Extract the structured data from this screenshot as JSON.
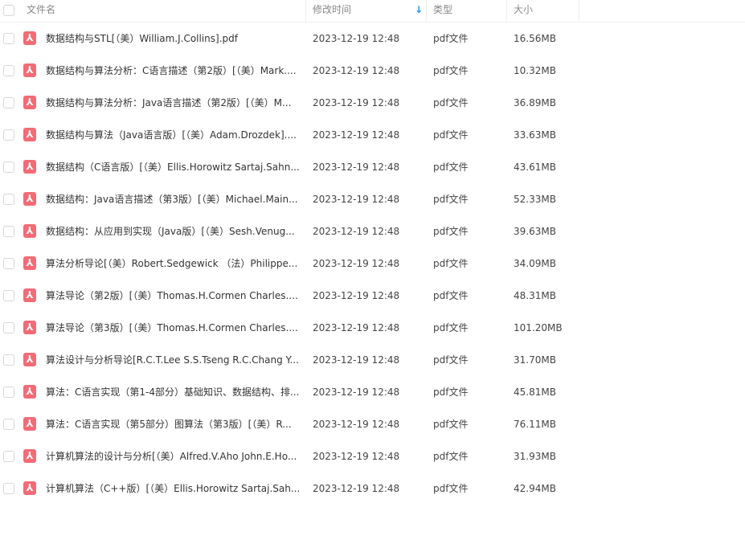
{
  "header": {
    "name": "文件名",
    "time": "修改时间",
    "type": "类型",
    "size": "大小",
    "sort_icon": "arrow-down-icon",
    "sort_color": "#1e90ff"
  },
  "icon_color": "#f26b76",
  "files": [
    {
      "name": "数据结构与STL[（美）William.J.Collins].pdf",
      "time": "2023-12-19 12:48",
      "type": "pdf文件",
      "size": "16.56MB"
    },
    {
      "name": "数据结构与算法分析：C语言描述（第2版）[（美）Mark....",
      "time": "2023-12-19 12:48",
      "type": "pdf文件",
      "size": "10.32MB"
    },
    {
      "name": "数据结构与算法分析：Java语言描述（第2版）[（美）M...",
      "time": "2023-12-19 12:48",
      "type": "pdf文件",
      "size": "36.89MB"
    },
    {
      "name": "数据结构与算法（Java语言版）[（美）Adam.Drozdek]....",
      "time": "2023-12-19 12:48",
      "type": "pdf文件",
      "size": "33.63MB"
    },
    {
      "name": "数据结构（C语言版）[（美）Ellis.Horowitz Sartaj.Sahn...",
      "time": "2023-12-19 12:48",
      "type": "pdf文件",
      "size": "43.61MB"
    },
    {
      "name": "数据结构：Java语言描述（第3版）[（美）Michael.Main...",
      "time": "2023-12-19 12:48",
      "type": "pdf文件",
      "size": "52.33MB"
    },
    {
      "name": "数据结构：从应用到实现（Java版）[（美）Sesh.Venug...",
      "time": "2023-12-19 12:48",
      "type": "pdf文件",
      "size": "39.63MB"
    },
    {
      "name": "算法分析导论[（美）Robert.Sedgewick （法）Philippe...",
      "time": "2023-12-19 12:48",
      "type": "pdf文件",
      "size": "34.09MB"
    },
    {
      "name": "算法导论（第2版）[（美）Thomas.H.Cormen Charles....",
      "time": "2023-12-19 12:48",
      "type": "pdf文件",
      "size": "48.31MB"
    },
    {
      "name": "算法导论（第3版）[（美）Thomas.H.Cormen Charles....",
      "time": "2023-12-19 12:48",
      "type": "pdf文件",
      "size": "101.20MB"
    },
    {
      "name": "算法设计与分析导论[R.C.T.Lee S.S.Tseng R.C.Chang Y....",
      "time": "2023-12-19 12:48",
      "type": "pdf文件",
      "size": "31.70MB"
    },
    {
      "name": "算法：C语言实现（第1-4部分）基础知识、数据结构、排...",
      "time": "2023-12-19 12:48",
      "type": "pdf文件",
      "size": "45.81MB"
    },
    {
      "name": "算法：C语言实现（第5部分）图算法（第3版）[（美）R...",
      "time": "2023-12-19 12:48",
      "type": "pdf文件",
      "size": "76.11MB"
    },
    {
      "name": "计算机算法的设计与分析[（美）Alfred.V.Aho John.E.Ho...",
      "time": "2023-12-19 12:48",
      "type": "pdf文件",
      "size": "31.93MB"
    },
    {
      "name": "计算机算法（C++版）[（美）Ellis.Horowitz Sartaj.Sah...",
      "time": "2023-12-19 12:48",
      "type": "pdf文件",
      "size": "42.94MB"
    }
  ]
}
